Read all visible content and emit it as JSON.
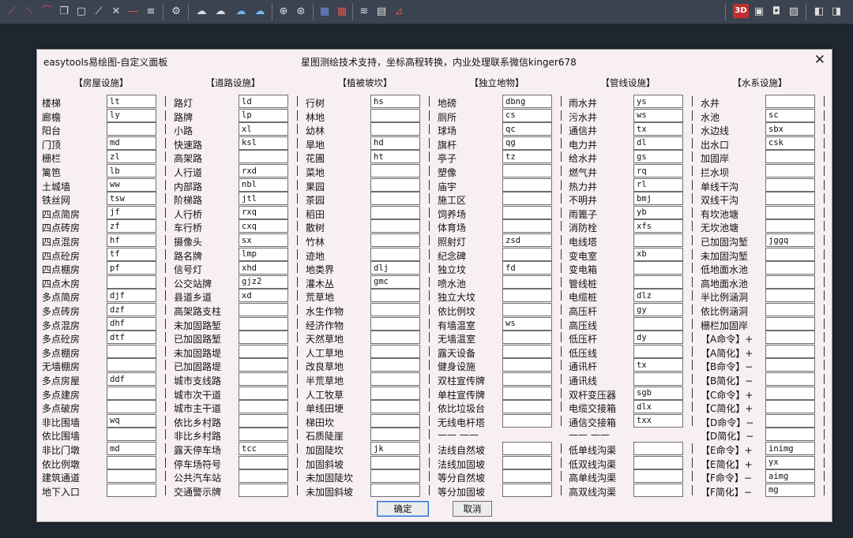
{
  "toolbar": {
    "right_label_3d": "3D"
  },
  "dialog": {
    "title": "easytools易绘图-自定义面板",
    "subtitle": "星图测绘技术支持，坐标高程转换，内业处理联系微信kinger678",
    "close_label": "✕",
    "ok_label": "确定",
    "cancel_label": "取消"
  },
  "columns": [
    {
      "header": "【房屋设施】",
      "rows": [
        {
          "label": "楼梯",
          "value": "lt"
        },
        {
          "label": "廊檐",
          "value": "ly"
        },
        {
          "label": "阳台",
          "value": ""
        },
        {
          "label": "门顶",
          "value": "md"
        },
        {
          "label": "栅栏",
          "value": "zl"
        },
        {
          "label": "篱笆",
          "value": "lb"
        },
        {
          "label": "土城墙",
          "value": "ww"
        },
        {
          "label": "铁丝网",
          "value": "tsw"
        },
        {
          "label": "四点简房",
          "value": "jf"
        },
        {
          "label": "四点砖房",
          "value": "zf"
        },
        {
          "label": "四点混房",
          "value": "hf"
        },
        {
          "label": "四点砼房",
          "value": "tf"
        },
        {
          "label": "四点棚房",
          "value": "pf"
        },
        {
          "label": "四点木房",
          "value": ""
        },
        {
          "label": "多点简房",
          "value": "djf"
        },
        {
          "label": "多点砖房",
          "value": "dzf"
        },
        {
          "label": "多点混房",
          "value": "dhf"
        },
        {
          "label": "多点砼房",
          "value": "dtf"
        },
        {
          "label": "多点棚房",
          "value": ""
        },
        {
          "label": "无墙棚房",
          "value": ""
        },
        {
          "label": "多点房屋",
          "value": "ddf"
        },
        {
          "label": "多点建房",
          "value": ""
        },
        {
          "label": "多点破房",
          "value": ""
        },
        {
          "label": "非比围墙",
          "value": "wq"
        },
        {
          "label": "依比围墙",
          "value": ""
        },
        {
          "label": "非比门墩",
          "value": "md"
        },
        {
          "label": "依比例墩",
          "value": ""
        },
        {
          "label": "建筑通道",
          "value": ""
        },
        {
          "label": "地下入口",
          "value": ""
        }
      ]
    },
    {
      "header": "【道路设施】",
      "rows": [
        {
          "label": "路灯",
          "value": "ld"
        },
        {
          "label": "路牌",
          "value": "lp"
        },
        {
          "label": "小路",
          "value": "xl"
        },
        {
          "label": "快速路",
          "value": "ksl"
        },
        {
          "label": "高架路",
          "value": ""
        },
        {
          "label": "人行道",
          "value": "rxd"
        },
        {
          "label": "内部路",
          "value": "nbl"
        },
        {
          "label": "阶梯路",
          "value": "jtl"
        },
        {
          "label": "人行桥",
          "value": "rxq"
        },
        {
          "label": "车行桥",
          "value": "cxq"
        },
        {
          "label": "摄像头",
          "value": "sx"
        },
        {
          "label": "路名牌",
          "value": "lmp"
        },
        {
          "label": "信号灯",
          "value": "xhd"
        },
        {
          "label": "公交站牌",
          "value": "gjz2"
        },
        {
          "label": "县道乡道",
          "value": "xd"
        },
        {
          "label": "高架路支柱",
          "value": ""
        },
        {
          "label": "未加固路堑",
          "value": ""
        },
        {
          "label": "已加固路堑",
          "value": ""
        },
        {
          "label": "未加固路堤",
          "value": ""
        },
        {
          "label": "已加固路堤",
          "value": ""
        },
        {
          "label": "城市支线路",
          "value": ""
        },
        {
          "label": "城市次干道",
          "value": ""
        },
        {
          "label": "城市主干道",
          "value": ""
        },
        {
          "label": "依比乡村路",
          "value": ""
        },
        {
          "label": "非比乡村路",
          "value": ""
        },
        {
          "label": "露天停车场",
          "value": "tcc"
        },
        {
          "label": "停车场符号",
          "value": ""
        },
        {
          "label": "公共汽车站",
          "value": ""
        },
        {
          "label": "交通警示牌",
          "value": ""
        }
      ]
    },
    {
      "header": "【植被坡坎】",
      "rows": [
        {
          "label": "行树",
          "value": "hs"
        },
        {
          "label": "林地",
          "value": ""
        },
        {
          "label": "幼林",
          "value": ""
        },
        {
          "label": "旱地",
          "value": "hd"
        },
        {
          "label": "花圃",
          "value": "ht"
        },
        {
          "label": "菜地",
          "value": ""
        },
        {
          "label": "果园",
          "value": ""
        },
        {
          "label": "茶园",
          "value": ""
        },
        {
          "label": "稻田",
          "value": ""
        },
        {
          "label": "散树",
          "value": ""
        },
        {
          "label": "竹林",
          "value": ""
        },
        {
          "label": "迹地",
          "value": ""
        },
        {
          "label": "地类界",
          "value": "dlj"
        },
        {
          "label": "灌木丛",
          "value": "gmc"
        },
        {
          "label": "荒草地",
          "value": ""
        },
        {
          "label": "水生作物",
          "value": ""
        },
        {
          "label": "经济作物",
          "value": ""
        },
        {
          "label": "天然草地",
          "value": ""
        },
        {
          "label": "人工草地",
          "value": ""
        },
        {
          "label": "改良草地",
          "value": ""
        },
        {
          "label": "半荒草地",
          "value": ""
        },
        {
          "label": "人工牧草",
          "value": ""
        },
        {
          "label": "单线田埂",
          "value": ""
        },
        {
          "label": "梯田坎",
          "value": ""
        },
        {
          "label": "石质陡崖",
          "value": ""
        },
        {
          "label": "加固陡坎",
          "value": "jk"
        },
        {
          "label": "加固斜坡",
          "value": ""
        },
        {
          "label": "未加固陡坎",
          "value": ""
        },
        {
          "label": "未加固斜坡",
          "value": ""
        }
      ]
    },
    {
      "header": "【独立地物】",
      "rows": [
        {
          "label": "地磅",
          "value": "dbng"
        },
        {
          "label": "厕所",
          "value": "cs"
        },
        {
          "label": "球场",
          "value": "qc"
        },
        {
          "label": "旗杆",
          "value": "qg"
        },
        {
          "label": "亭子",
          "value": "tz"
        },
        {
          "label": "塑像",
          "value": ""
        },
        {
          "label": "庙宇",
          "value": ""
        },
        {
          "label": "施工区",
          "value": ""
        },
        {
          "label": "饲养场",
          "value": ""
        },
        {
          "label": "体育场",
          "value": ""
        },
        {
          "label": "照射灯",
          "value": "zsd"
        },
        {
          "label": "纪念碑",
          "value": ""
        },
        {
          "label": "独立坟",
          "value": "fd"
        },
        {
          "label": "喷水池",
          "value": ""
        },
        {
          "label": "独立大坟",
          "value": ""
        },
        {
          "label": "依比例坟",
          "value": ""
        },
        {
          "label": "有墙温室",
          "value": "ws"
        },
        {
          "label": "无墙温室",
          "value": ""
        },
        {
          "label": "露天设备",
          "value": ""
        },
        {
          "label": "健身设施",
          "value": ""
        },
        {
          "label": "双柱宣传牌",
          "value": ""
        },
        {
          "label": "单柱宣传牌",
          "value": ""
        },
        {
          "label": "依比垃圾台",
          "value": ""
        },
        {
          "label": "无线电杆塔",
          "value": ""
        },
        {
          "label": "——  ——",
          "value": ""
        },
        {
          "label": "法线自然坡",
          "value": ""
        },
        {
          "label": "法线加固坡",
          "value": ""
        },
        {
          "label": "等分自然坡",
          "value": ""
        },
        {
          "label": "等分加固坡",
          "value": ""
        }
      ]
    },
    {
      "header": "【管线设施】",
      "rows": [
        {
          "label": "雨水井",
          "value": "ys"
        },
        {
          "label": "污水井",
          "value": "ws"
        },
        {
          "label": "通信井",
          "value": "tx"
        },
        {
          "label": "电力井",
          "value": "dl"
        },
        {
          "label": "给水井",
          "value": "gs"
        },
        {
          "label": "燃气井",
          "value": "rq"
        },
        {
          "label": "热力井",
          "value": "rl"
        },
        {
          "label": "不明井",
          "value": "bmj"
        },
        {
          "label": "雨篦子",
          "value": "yb"
        },
        {
          "label": "消防栓",
          "value": "xfs"
        },
        {
          "label": "电线塔",
          "value": ""
        },
        {
          "label": "变电室",
          "value": "xb"
        },
        {
          "label": "变电箱",
          "value": ""
        },
        {
          "label": "管线桩",
          "value": ""
        },
        {
          "label": "电缆桩",
          "value": "dlz"
        },
        {
          "label": "高压杆",
          "value": "gy"
        },
        {
          "label": "高压线",
          "value": ""
        },
        {
          "label": "低压杆",
          "value": "dy"
        },
        {
          "label": "低压线",
          "value": ""
        },
        {
          "label": "通讯杆",
          "value": "tx"
        },
        {
          "label": "通讯线",
          "value": ""
        },
        {
          "label": "双杆变压器",
          "value": "sgb"
        },
        {
          "label": "电缆交接箱",
          "value": "dlx"
        },
        {
          "label": "通信交接箱",
          "value": "txx"
        },
        {
          "label": "——  ——",
          "value": ""
        },
        {
          "label": "低单线沟渠",
          "value": ""
        },
        {
          "label": "低双线沟渠",
          "value": ""
        },
        {
          "label": "高单线沟渠",
          "value": ""
        },
        {
          "label": "高双线沟渠",
          "value": ""
        }
      ]
    },
    {
      "header": "【水系设施】",
      "rows": [
        {
          "label": "水井",
          "value": ""
        },
        {
          "label": "水池",
          "value": "sc"
        },
        {
          "label": "水边线",
          "value": "sbx"
        },
        {
          "label": "出水口",
          "value": "csk"
        },
        {
          "label": "加固岸",
          "value": ""
        },
        {
          "label": "拦水坝",
          "value": ""
        },
        {
          "label": "单线干沟",
          "value": ""
        },
        {
          "label": "双线干沟",
          "value": ""
        },
        {
          "label": "有坎池塘",
          "value": ""
        },
        {
          "label": "无坎池塘",
          "value": ""
        },
        {
          "label": "已加固沟堑",
          "value": "jggq"
        },
        {
          "label": "未加固沟堑",
          "value": ""
        },
        {
          "label": "低地面水池",
          "value": ""
        },
        {
          "label": "高地面水池",
          "value": ""
        },
        {
          "label": "半比例涵洞",
          "value": ""
        },
        {
          "label": "依比例涵洞",
          "value": ""
        },
        {
          "label": "栅栏加固岸",
          "value": ""
        },
        {
          "label": "【A命令】+",
          "value": ""
        },
        {
          "label": "【A简化】+",
          "value": ""
        },
        {
          "label": "【B命令】−",
          "value": ""
        },
        {
          "label": "【B简化】−",
          "value": ""
        },
        {
          "label": "【C命令】+",
          "value": ""
        },
        {
          "label": "【C简化】+",
          "value": ""
        },
        {
          "label": "【D命令】−",
          "value": ""
        },
        {
          "label": "【D简化】−",
          "value": ""
        },
        {
          "label": "【E命令】+",
          "value": "inimg"
        },
        {
          "label": "【E简化】+",
          "value": "yx"
        },
        {
          "label": "【F命令】−",
          "value": "aimg"
        },
        {
          "label": "【F简化】−",
          "value": "mg"
        }
      ]
    }
  ]
}
